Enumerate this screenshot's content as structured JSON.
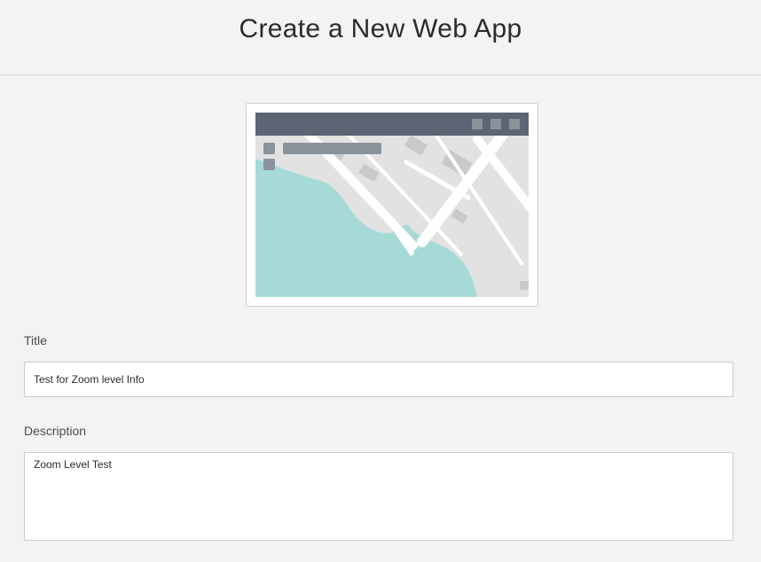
{
  "header": {
    "title": "Create a New Web App"
  },
  "thumbnail": {
    "icon": "map-thumbnail",
    "colors": {
      "titlebar": "#5b6574",
      "titlebar_buttons": "#8a929c",
      "land": "#e2e2e2",
      "water": "#a6dad7",
      "roads": "#ffffff",
      "buildings": "#c9c9c9",
      "controls": "#8a929c"
    }
  },
  "form": {
    "title_label": "Title",
    "title_value": "Test for Zoom level Info",
    "description_label": "Description",
    "description_value": "Zoom Level Test"
  }
}
